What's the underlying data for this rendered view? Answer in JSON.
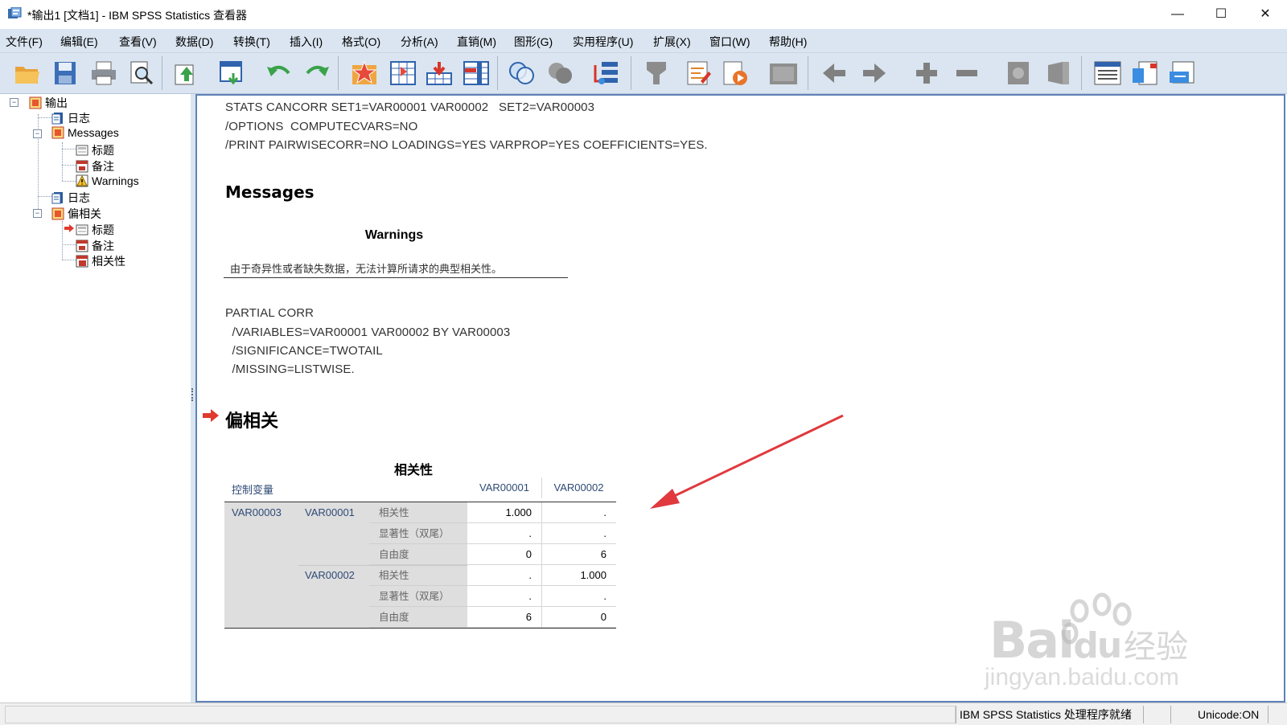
{
  "window": {
    "title": "*输出1 [文档1] - IBM SPSS Statistics 查看器",
    "controls": {
      "minimize": "—",
      "maximize": "☐",
      "close": "✕"
    }
  },
  "menubar": {
    "items": [
      {
        "label": "文件(F)"
      },
      {
        "label": "编辑(E)"
      },
      {
        "label": "查看(V)"
      },
      {
        "label": "数据(D)"
      },
      {
        "label": "转换(T)"
      },
      {
        "label": "插入(I)"
      },
      {
        "label": "格式(O)"
      },
      {
        "label": "分析(A)"
      },
      {
        "label": "直销(M)"
      },
      {
        "label": "图形(G)"
      },
      {
        "label": "实用程序(U)"
      },
      {
        "label": "扩展(X)"
      },
      {
        "label": "窗口(W)"
      },
      {
        "label": "帮助(H)"
      }
    ]
  },
  "toolbar": {
    "buttons": [
      "open-icon",
      "save-icon",
      "print-icon",
      "print-preview-icon",
      "export-icon",
      "goto-data-icon",
      "undo-icon",
      "redo-icon",
      "goto-case-icon",
      "goto-variable-icon",
      "variables-icon",
      "insert-cases-icon",
      "use-sets-icon",
      "show-all-icon",
      "spelling-icon",
      "designate-window-icon",
      "new-heading-icon",
      "new-title-icon",
      "new-text-icon",
      "insert-chart-icon",
      "promote-icon",
      "demote-icon",
      "expand-icon",
      "collapse-icon",
      "show-icon",
      "hide-icon",
      "insert-output-icon",
      "export-doc-icon",
      "send-icon"
    ]
  },
  "outline": {
    "root": "输出",
    "items": [
      {
        "label": "日志",
        "icon": "log-icon"
      },
      {
        "label": "Messages",
        "icon": "heading-icon"
      },
      {
        "label": "标题",
        "icon": "title-icon"
      },
      {
        "label": "备注",
        "icon": "notes-icon"
      },
      {
        "label": "Warnings",
        "icon": "warning-icon"
      },
      {
        "label": "日志",
        "icon": "log-icon"
      },
      {
        "label": "偏相关",
        "icon": "heading-icon"
      },
      {
        "label": "标题",
        "icon": "title-icon"
      },
      {
        "label": "备注",
        "icon": "notes-icon"
      },
      {
        "label": "相关性",
        "icon": "table-icon"
      }
    ]
  },
  "content": {
    "syntax1": [
      "STATS CANCORR SET1=VAR00001 VAR00002   SET2=VAR00003",
      "/OPTIONS  COMPUTECVARS=NO",
      "/PRINT PAIRWISECORR=NO LOADINGS=YES VARPROP=YES COEFFICIENTS=YES."
    ],
    "messages_heading": "Messages",
    "warnings_title": "Warnings",
    "warnings_text": "由于奇异性或者缺失数据，无法计算所请求的典型相关性。",
    "syntax2": [
      "PARTIAL CORR",
      "  /VARIABLES=VAR00001 VAR00002 BY VAR00003",
      "  /SIGNIFICANCE=TWOTAIL",
      "  /MISSING=LISTWISE."
    ],
    "partial_heading": "偏相关",
    "table": {
      "title": "相关性",
      "control_label": "控制变量",
      "col_headers": [
        "VAR00001",
        "VAR00002"
      ],
      "control_var": "VAR00003",
      "rows": [
        {
          "var": "VAR00001",
          "stats": [
            {
              "label": "相关性",
              "values": [
                "1.000",
                "."
              ]
            },
            {
              "label": "显著性（双尾）",
              "values": [
                ".",
                "."
              ]
            },
            {
              "label": "自由度",
              "values": [
                "0",
                "6"
              ]
            }
          ]
        },
        {
          "var": "VAR00002",
          "stats": [
            {
              "label": "相关性",
              "values": [
                ".",
                "1.000"
              ]
            },
            {
              "label": "显著性（双尾）",
              "values": [
                ".",
                "."
              ]
            },
            {
              "label": "自由度",
              "values": [
                "6",
                "0"
              ]
            }
          ]
        }
      ]
    }
  },
  "statusbar": {
    "processor": "IBM SPSS Statistics 处理程序就绪",
    "unicode": "Unicode:ON"
  },
  "watermark": {
    "logo": "Bai",
    "logo2": "du",
    "cn": "经验",
    "url": "jingyan.baidu.com"
  },
  "colors": {
    "menubar_bg": "#dae5f1",
    "content_border": "#5f82b9",
    "annotation_arrow": "#e0393e",
    "table_gray": "#dedede"
  }
}
